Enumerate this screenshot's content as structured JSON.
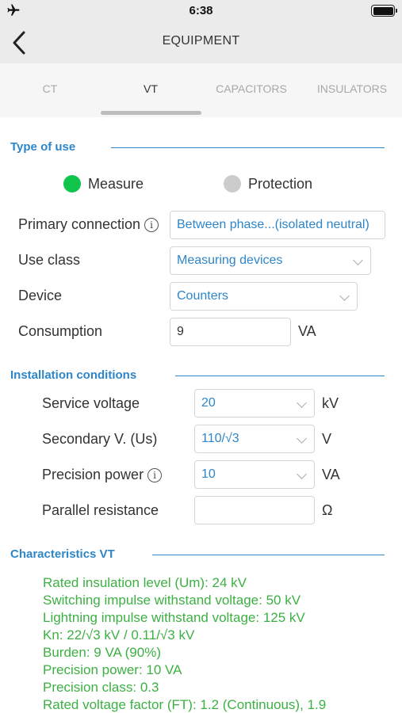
{
  "status": {
    "time": "6:38"
  },
  "nav": {
    "title": "EQUIPMENT"
  },
  "tabs": [
    {
      "label": "CT",
      "active": false
    },
    {
      "label": "VT",
      "active": true
    },
    {
      "label": "CAPACITORS",
      "active": false
    },
    {
      "label": "INSULATORS",
      "active": false
    }
  ],
  "type_of_use": {
    "header": "Type of use",
    "options": [
      {
        "label": "Measure",
        "selected": true,
        "color": "#10c44c"
      },
      {
        "label": "Protection",
        "selected": false,
        "color": "#cccccc"
      }
    ],
    "primary_connection": {
      "label": "Primary connection",
      "value": "Between phase...(isolated neutral)"
    },
    "use_class": {
      "label": "Use class",
      "value": "Measuring devices"
    },
    "device": {
      "label": "Device",
      "value": "Counters"
    },
    "consumption": {
      "label": "Consumption",
      "value": "9",
      "unit": "VA"
    }
  },
  "installation": {
    "header": "Installation conditions",
    "service_voltage": {
      "label": "Service voltage",
      "value": "20",
      "unit": "kV"
    },
    "secondary_voltage": {
      "label": "Secondary V. (Us)",
      "value": "110/√3",
      "unit": "V"
    },
    "precision_power": {
      "label": "Precision power",
      "value": "10",
      "unit": "VA"
    },
    "parallel_resistance": {
      "label": "Parallel resistance",
      "value": "",
      "unit": "Ω"
    }
  },
  "characteristics": {
    "header": "Characteristics VT",
    "lines": [
      "Rated insulation level (Um): 24 kV",
      "Switching impulse withstand voltage: 50 kV",
      "Lightning impulse withstand voltage: 125 kV",
      "Kn: 22/√3 kV / 0.11/√3 kV",
      "Burden: 9 VA (90%)",
      "Precision power: 10 VA",
      "Precision class: 0.3",
      "Rated voltage factor (FT): 1.2 (Continuous), 1.9"
    ]
  },
  "colors": {
    "accent": "#2e86c9",
    "result_text": "#3cb043",
    "selected_radio": "#10c44c"
  },
  "icons": {
    "plane": "airplane-mode-icon",
    "battery": "battery-icon",
    "back": "chevron-left-icon",
    "info": "info-icon",
    "dropdown": "chevron-down-icon"
  }
}
